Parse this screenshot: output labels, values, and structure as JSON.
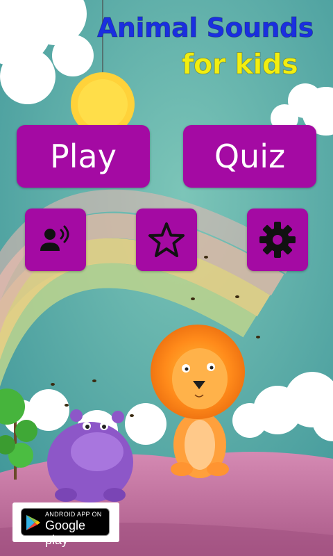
{
  "title": {
    "line1": "Animal Sounds",
    "line2": "for kids"
  },
  "buttons": {
    "play": "Play",
    "quiz": "Quiz"
  },
  "icons": {
    "sounds": "speaker-person-icon",
    "favorites": "star-icon",
    "settings": "gear-icon"
  },
  "badge": {
    "small": "ANDROID APP ON",
    "big": "Google play"
  },
  "colors": {
    "button_bg": "#a40aa3",
    "title_blue": "#1a2fe0",
    "title_yellow": "#f2ee10",
    "sky": "#4ea7a0",
    "ground": "#c4769f"
  }
}
